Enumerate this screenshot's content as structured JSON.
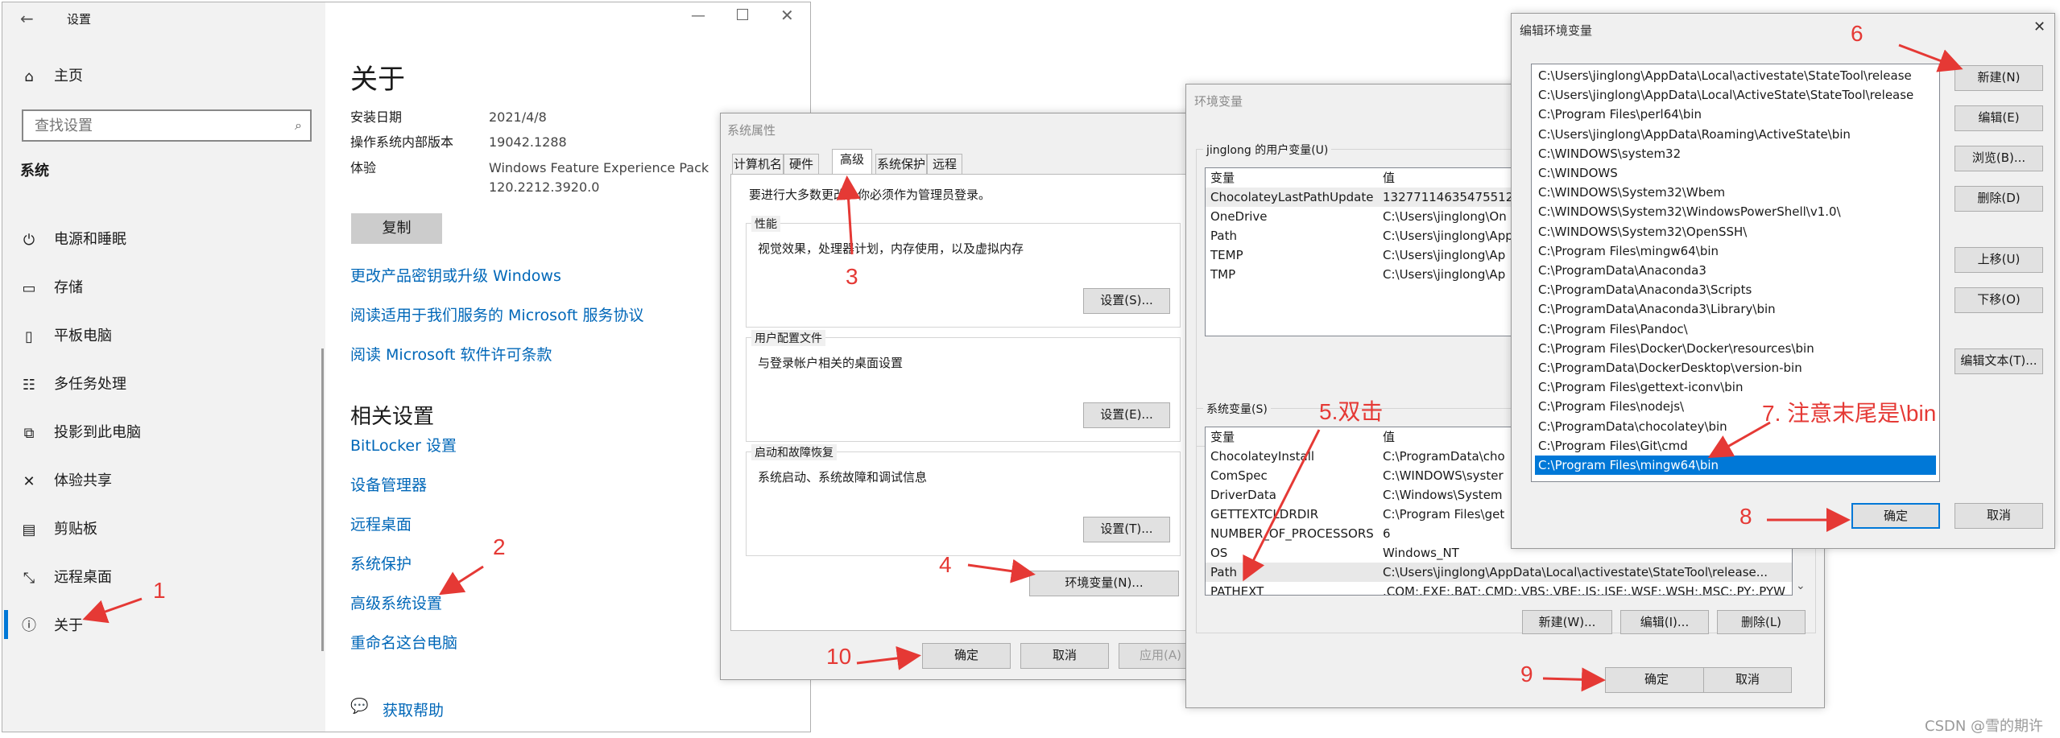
{
  "settings": {
    "title": "设置",
    "home": "主页",
    "search_placeholder": "查找设置",
    "section": "系统",
    "nav": [
      "电源和睡眠",
      "存储",
      "平板电脑",
      "多任务处理",
      "投影到此电脑",
      "体验共享",
      "剪贴板",
      "远程桌面",
      "关于"
    ],
    "page_title": "关于",
    "specs": [
      {
        "label": "安装日期",
        "value": "2021/4/8"
      },
      {
        "label": "操作系统内部版本",
        "value": "19042.1288"
      },
      {
        "label": "体验",
        "value": "Windows Feature Experience Pack",
        "value2": "120.2212.3920.0"
      }
    ],
    "copy_button": "复制",
    "links": [
      "更改产品密钥或升级 Windows",
      "阅读适用于我们服务的 Microsoft 服务协议",
      "阅读 Microsoft 软件许可条款"
    ],
    "related_title": "相关设置",
    "related": [
      "BitLocker 设置",
      "设备管理器",
      "远程桌面",
      "系统保护",
      "高级系统设置",
      "重命名这台电脑"
    ],
    "help": "获取帮助"
  },
  "sysprops": {
    "title": "系统属性",
    "tabs": [
      "计算机名",
      "硬件",
      "高级",
      "系统保护",
      "远程"
    ],
    "admin_note": "要进行大多数更改，你必须作为管理员登录。",
    "perf_title": "性能",
    "perf_desc": "视觉效果，处理器计划，内存使用，以及虚拟内存",
    "perf_btn": "设置(S)...",
    "profile_title": "用户配置文件",
    "profile_desc": "与登录帐户相关的桌面设置",
    "profile_btn": "设置(E)...",
    "startup_title": "启动和故障恢复",
    "startup_desc": "系统启动、系统故障和调试信息",
    "startup_btn": "设置(T)...",
    "env_btn": "环境变量(N)...",
    "ok": "确定",
    "cancel": "取消",
    "apply": "应用(A)"
  },
  "envvars": {
    "title": "环境变量",
    "user_group": "jinglong 的用户变量(U)",
    "col_var": "变量",
    "col_val": "值",
    "user_vars": [
      {
        "name": "ChocolateyLastPathUpdate",
        "value": "13277114635475512"
      },
      {
        "name": "OneDrive",
        "value": "C:\\Users\\jinglong\\On"
      },
      {
        "name": "Path",
        "value": "C:\\Users\\jinglong\\App"
      },
      {
        "name": "TEMP",
        "value": "C:\\Users\\jinglong\\Ap"
      },
      {
        "name": "TMP",
        "value": "C:\\Users\\jinglong\\Ap"
      }
    ],
    "sys_group": "系统变量(S)",
    "sys_vars": [
      {
        "name": "ChocolateyInstall",
        "value": "C:\\ProgramData\\cho"
      },
      {
        "name": "ComSpec",
        "value": "C:\\WINDOWS\\syster"
      },
      {
        "name": "DriverData",
        "value": "C:\\Windows\\System"
      },
      {
        "name": "GETTEXTCLDRDIR",
        "value": "C:\\Program Files\\get"
      },
      {
        "name": "NUMBER_OF_PROCESSORS",
        "value": "6"
      },
      {
        "name": "OS",
        "value": "Windows_NT"
      },
      {
        "name": "Path",
        "value": "C:\\Users\\jinglong\\AppData\\Local\\activestate\\StateTool\\release..."
      },
      {
        "name": "PATHEXT",
        "value": ".COM;.EXE;.BAT;.CMD;.VBS;.VBE;.JS;.JSE;.WSF;.WSH;.MSC;.PY;.PYW"
      }
    ],
    "new_btn": "新建(W)...",
    "edit_btn": "编辑(I)...",
    "delete_btn": "删除(L)",
    "ok": "确定",
    "cancel": "取消"
  },
  "editenv": {
    "title": "编辑环境变量",
    "paths": [
      "C:\\Users\\jinglong\\AppData\\Local\\activestate\\StateTool\\release",
      "C:\\Users\\jinglong\\AppData\\Local\\ActiveState\\StateTool\\release",
      "C:\\Program Files\\perl64\\bin",
      "C:\\Users\\jinglong\\AppData\\Roaming\\ActiveState\\bin",
      "C:\\WINDOWS\\system32",
      "C:\\WINDOWS",
      "C:\\WINDOWS\\System32\\Wbem",
      "C:\\WINDOWS\\System32\\WindowsPowerShell\\v1.0\\",
      "C:\\WINDOWS\\System32\\OpenSSH\\",
      "C:\\Program Files\\mingw64\\bin",
      "C:\\ProgramData\\Anaconda3",
      "C:\\ProgramData\\Anaconda3\\Scripts",
      "C:\\ProgramData\\Anaconda3\\Library\\bin",
      "C:\\Program Files\\Pandoc\\",
      "C:\\Program Files\\Docker\\Docker\\resources\\bin",
      "C:\\ProgramData\\DockerDesktop\\version-bin",
      "C:\\Program Files\\gettext-iconv\\bin",
      "C:\\Program Files\\nodejs\\",
      "C:\\ProgramData\\chocolatey\\bin",
      "C:\\Program Files\\Git\\cmd",
      "C:\\Program Files\\mingw64\\bin"
    ],
    "buttons": [
      "新建(N)",
      "编辑(E)",
      "浏览(B)...",
      "删除(D)",
      "上移(U)",
      "下移(O)",
      "编辑文本(T)..."
    ],
    "ok": "确定",
    "cancel": "取消"
  },
  "annotations": [
    "1",
    "2",
    "3",
    "4",
    "5.双击",
    "6",
    "7. 注意末尾是\\bin",
    "8",
    "9",
    "10"
  ],
  "watermark": "CSDN @雪的期许",
  "colors": {
    "accent": "#0078d7",
    "annotation": "#e53935",
    "link": "#0067b8"
  }
}
